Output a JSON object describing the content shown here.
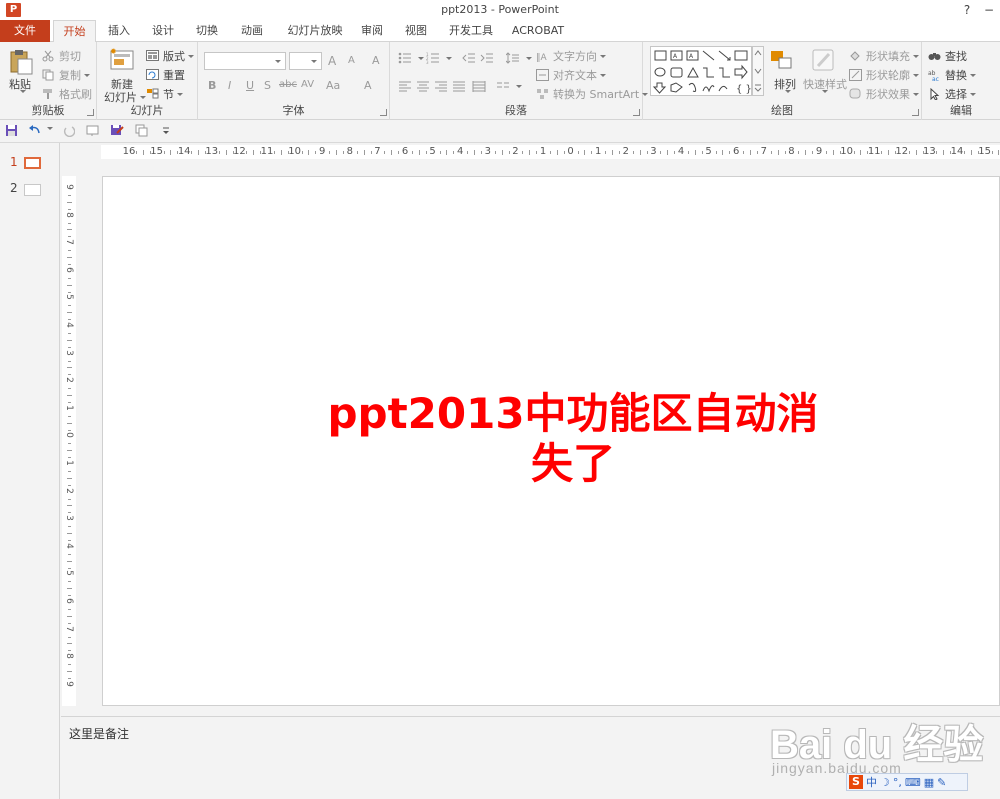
{
  "window": {
    "title": "ppt2013 - PowerPoint",
    "help": "?",
    "minimize": "−"
  },
  "app_logo": "P",
  "tabs": [
    {
      "label": "文件"
    },
    {
      "label": "开始"
    },
    {
      "label": "插入"
    },
    {
      "label": "设计"
    },
    {
      "label": "切换"
    },
    {
      "label": "动画"
    },
    {
      "label": "幻灯片放映"
    },
    {
      "label": "审阅"
    },
    {
      "label": "视图"
    },
    {
      "label": "开发工具"
    },
    {
      "label": "ACROBAT"
    }
  ],
  "ribbon": {
    "clipboard": {
      "label": "剪贴板",
      "paste": "粘贴",
      "cut": "剪切",
      "copy": "复制",
      "format_painter": "格式刷"
    },
    "slides": {
      "label": "幻灯片",
      "new_slide_1": "新建",
      "new_slide_2": "幻灯片",
      "layout": "版式",
      "reset": "重置",
      "section": "节"
    },
    "font": {
      "label": "字体",
      "bold": "B",
      "italic": "I",
      "underline": "U",
      "shadow": "S",
      "strike": "abc",
      "spacing": "AV",
      "case": "Aa",
      "color": "A",
      "grow": "A",
      "shrink": "A",
      "clear": "A"
    },
    "paragraph": {
      "label": "段落",
      "text_direction": "文字方向",
      "align_text": "对齐文本",
      "smartart": "转换为 SmartArt"
    },
    "drawing": {
      "label": "绘图",
      "arrange": "排列",
      "quick_styles": "快速样式",
      "shape_fill": "形状填充",
      "shape_outline": "形状轮廓",
      "shape_effects": "形状效果"
    },
    "editing": {
      "label": "编辑",
      "find": "查找",
      "replace": "替换",
      "select": "选择"
    }
  },
  "thumbnails": [
    {
      "num": "1"
    },
    {
      "num": "2"
    }
  ],
  "ruler": {
    "h": [
      "16",
      "15",
      "14",
      "13",
      "12",
      "11",
      "10",
      "9",
      "8",
      "7",
      "6",
      "5",
      "4",
      "3",
      "2",
      "1",
      "0",
      "1",
      "2",
      "3",
      "4",
      "5",
      "6",
      "7",
      "8",
      "9",
      "10",
      "11",
      "12",
      "13",
      "14",
      "15"
    ],
    "v": [
      "9",
      "8",
      "7",
      "6",
      "5",
      "4",
      "3",
      "2",
      "1",
      "0",
      "1",
      "2",
      "3",
      "4",
      "5",
      "6",
      "7",
      "8",
      "9"
    ]
  },
  "slide": {
    "title_line1": "ppt2013中功能区自动消",
    "title_line2": "失了",
    "title_color": "#ff0000"
  },
  "notes": {
    "text": "这里是备注"
  },
  "watermark": {
    "main": "Bai du 经验",
    "sub": "jingyan.baidu.com"
  },
  "ime": {
    "logo": "S",
    "mode": "中"
  },
  "colors": {
    "accent": "#c43e1c",
    "file_tab": "#c43e1c",
    "ribbon_bg": "#f3f3f3"
  }
}
